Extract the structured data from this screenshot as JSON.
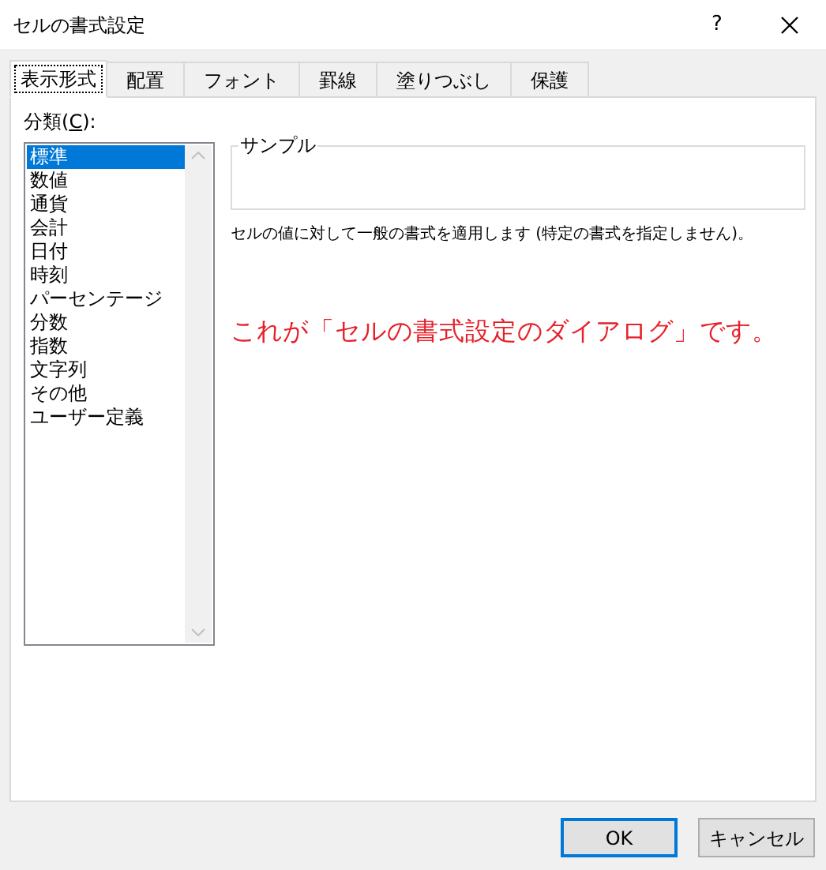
{
  "window": {
    "title": "セルの書式設定",
    "help": "?"
  },
  "tabs": [
    {
      "label": "表示形式",
      "selected": true
    },
    {
      "label": "配置",
      "selected": false
    },
    {
      "label": "フォント",
      "selected": false
    },
    {
      "label": "罫線",
      "selected": false
    },
    {
      "label": "塗りつぶし",
      "selected": false
    },
    {
      "label": "保護",
      "selected": false
    }
  ],
  "category": {
    "label": "分類(**C**):",
    "items": [
      {
        "label": "標準",
        "selected": true
      },
      {
        "label": "数値",
        "selected": false
      },
      {
        "label": "通貨",
        "selected": false
      },
      {
        "label": "会計",
        "selected": false
      },
      {
        "label": "日付",
        "selected": false
      },
      {
        "label": "時刻",
        "selected": false
      },
      {
        "label": "パーセンテージ",
        "selected": false
      },
      {
        "label": "分数",
        "selected": false
      },
      {
        "label": "指数",
        "selected": false
      },
      {
        "label": "文字列",
        "selected": false
      },
      {
        "label": "その他",
        "selected": false
      },
      {
        "label": "ユーザー定義",
        "selected": false
      }
    ]
  },
  "sample": {
    "label": "サンプル"
  },
  "description": "セルの値に対して一般の書式を適用します (特定の書式を指定しません)。",
  "annotation": "これが「セルの書式設定のダイアログ」です。",
  "buttons": [
    {
      "label": "OK",
      "selected": true
    },
    {
      "label": "キャンセル",
      "selected": false
    }
  ]
}
